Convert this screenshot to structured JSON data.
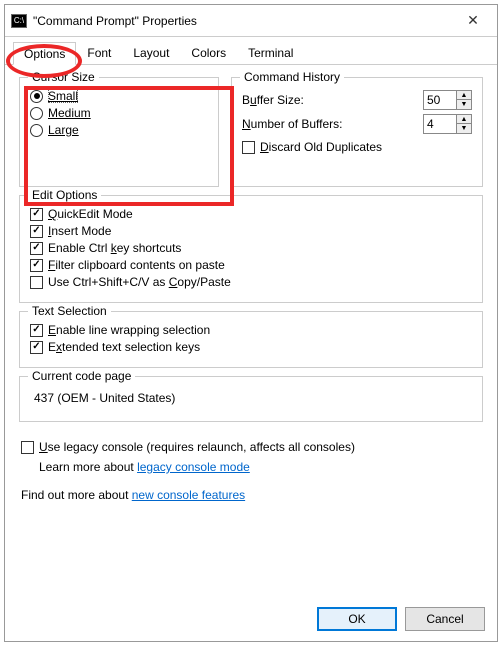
{
  "title": "\"Command Prompt\" Properties",
  "tabs": {
    "t0": "Options",
    "t1": "Font",
    "t2": "Layout",
    "t3": "Colors",
    "t4": "Terminal"
  },
  "cursor": {
    "title": "Cursor Size",
    "small": "Small",
    "medium": "Medium",
    "large": "Large"
  },
  "history": {
    "title": "Command History",
    "buffer_label_pre": "B",
    "buffer_label_u": "u",
    "buffer_label_post": "ffer Size:",
    "num_label_pre": "",
    "num_label_u": "N",
    "num_label_post": "umber of Buffers:",
    "buffer_value": "50",
    "num_value": "4",
    "discard_pre": "",
    "discard_u": "D",
    "discard_post": "iscard Old Duplicates"
  },
  "edit": {
    "title": "Edit Options",
    "quick_pre": "",
    "quick_u": "Q",
    "quick_post": "uickEdit Mode",
    "insert_pre": "",
    "insert_u": "I",
    "insert_post": "nsert Mode",
    "ctrl_pre": "Enable Ctrl ",
    "ctrl_u": "k",
    "ctrl_post": "ey shortcuts",
    "filter_pre": "",
    "filter_u": "F",
    "filter_post": "ilter clipboard contents on paste",
    "copy_pre": "Use Ctrl+Shift+C/V as ",
    "copy_u": "C",
    "copy_post": "opy/Paste"
  },
  "textsel": {
    "title": "Text Selection",
    "wrap_pre": "",
    "wrap_u": "E",
    "wrap_post": "nable line wrapping selection",
    "ext_pre": "E",
    "ext_u": "x",
    "ext_post": "tended text selection keys"
  },
  "codepage": {
    "title": "Current code page",
    "value": "437   (OEM - United States)"
  },
  "legacy": {
    "check_pre": "",
    "check_u": "U",
    "check_post": "se legacy console (requires relaunch, affects all consoles)",
    "learn_prefix": "Learn more about ",
    "learn_link": "legacy console mode"
  },
  "findout": {
    "prefix": "Find out more about ",
    "link": "new console features"
  },
  "buttons": {
    "ok": "OK",
    "cancel": "Cancel"
  }
}
